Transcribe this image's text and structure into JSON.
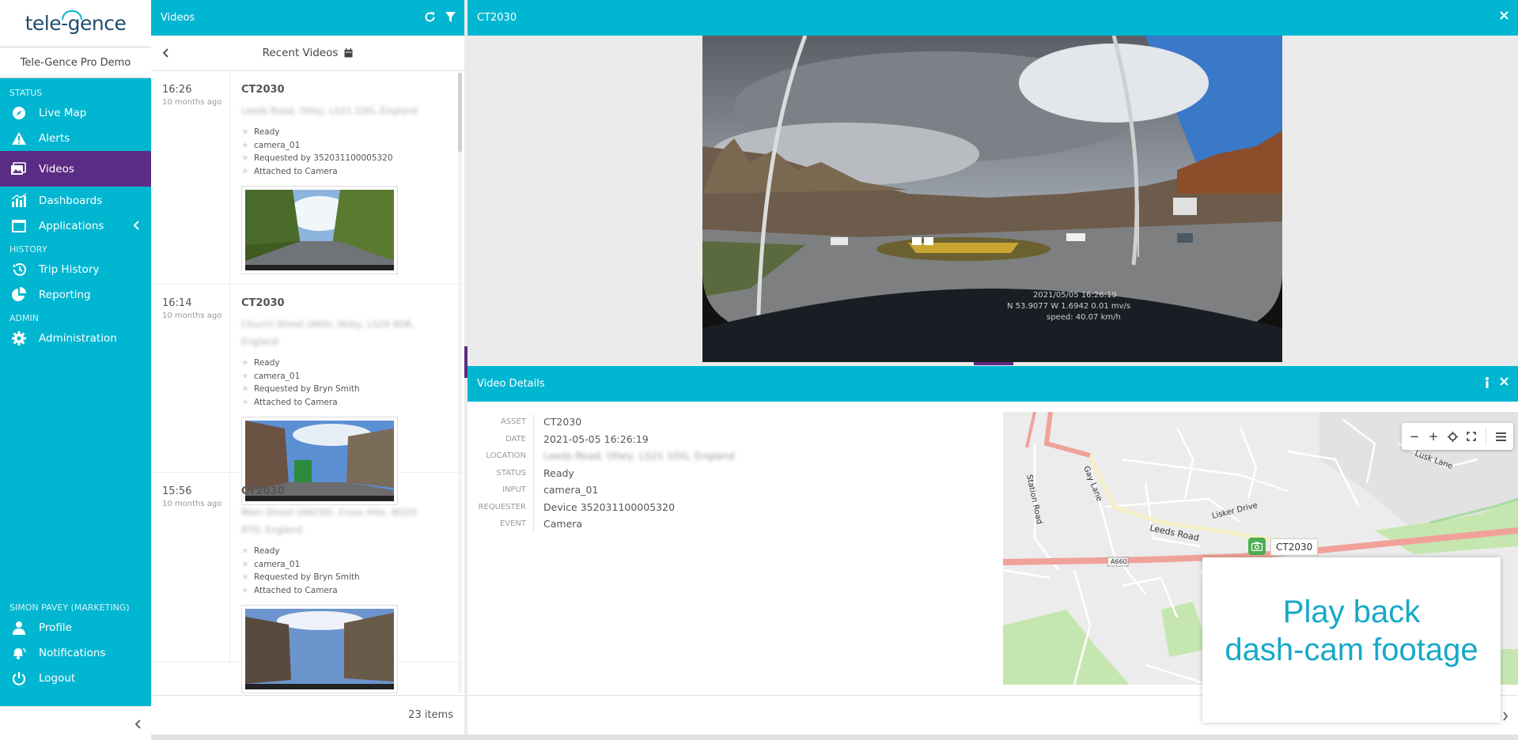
{
  "app": {
    "logo_text": "tele-gence",
    "org_name": "Tele-Gence Pro Demo"
  },
  "sidebar": {
    "sections": {
      "status": "STATUS",
      "history": "HISTORY",
      "admin": "ADMIN",
      "user": "SIMON PAVEY (MARKETING)"
    },
    "items": [
      {
        "label": "Live Map",
        "icon": "compass-icon"
      },
      {
        "label": "Alerts",
        "icon": "alert-triangle-icon"
      },
      {
        "label": "Videos",
        "icon": "video-icon",
        "active": true
      },
      {
        "label": "Dashboards",
        "icon": "bar-chart-icon"
      },
      {
        "label": "Applications",
        "icon": "window-icon"
      },
      {
        "label": "Trip History",
        "icon": "history-icon"
      },
      {
        "label": "Reporting",
        "icon": "pie-chart-icon"
      },
      {
        "label": "Administration",
        "icon": "gear-icon"
      },
      {
        "label": "Profile",
        "icon": "user-icon"
      },
      {
        "label": "Notifications",
        "icon": "bell-icon"
      },
      {
        "label": "Logout",
        "icon": "power-icon"
      }
    ]
  },
  "videos_panel": {
    "title": "Videos",
    "subtitle": "Recent Videos",
    "items_count": "23 items",
    "items": [
      {
        "time": "16:26",
        "ago": "10 months ago",
        "asset": "CT2030",
        "location": "Leeds Road, Otley, LS21 1DG, England",
        "attrs": [
          "Ready",
          "camera_01",
          "Requested by 352031100005320",
          "Attached to Camera"
        ]
      },
      {
        "time": "16:14",
        "ago": "10 months ago",
        "asset": "CT2030",
        "location": "Church Street (A65), Ilkley, LS29 9DR, England",
        "attrs": [
          "Ready",
          "camera_01",
          "Requested by Bryn Smith",
          "Attached to Camera"
        ]
      },
      {
        "time": "15:56",
        "ago": "10 months ago",
        "asset": "CT2030",
        "location": "Main Street (A6038), Cross Hills, BD20 8TD, England",
        "attrs": [
          "Ready",
          "camera_01",
          "Requested by Bryn Smith",
          "Attached to Camera"
        ]
      }
    ]
  },
  "video_panel": {
    "title": "CT2030",
    "overlay_line1": "2021/05/05 16:26:19",
    "overlay_line2": "N 53.9077 W 1.6942 0.01 mv/s",
    "overlay_line3": "speed: 40.07 km/h"
  },
  "details_panel": {
    "title": "Video Details",
    "fields": [
      {
        "key": "ASSET",
        "value": "CT2030"
      },
      {
        "key": "DATE",
        "value": "2021-05-05 16:26:19"
      },
      {
        "key": "LOCATION",
        "value": "Leeds Road, Otley, LS21 1DG, England"
      },
      {
        "key": "STATUS",
        "value": "Ready"
      },
      {
        "key": "INPUT",
        "value": "camera_01"
      },
      {
        "key": "REQUESTER",
        "value": "Device 352031100005320"
      },
      {
        "key": "EVENT",
        "value": "Camera"
      }
    ],
    "map": {
      "marker_label": "CT2030",
      "streets": [
        "Station Road",
        "Gay Lane",
        "Lisker Drive",
        "Leeds Road",
        "Lusk Lane",
        "A660"
      ]
    }
  },
  "promo": {
    "line1": "Play back",
    "line2": "dash-cam footage"
  },
  "colors": {
    "accent": "#00b6d0",
    "active": "#5b2c83",
    "promo_text": "#16a9c8"
  }
}
